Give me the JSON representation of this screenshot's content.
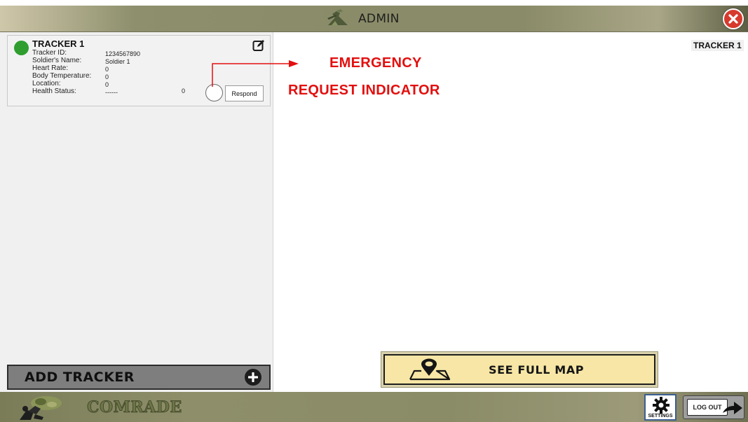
{
  "header": {
    "title": "ADMIN",
    "close_icon": "close-icon",
    "header_icon": "soldier-salute-icon"
  },
  "tracker_card": {
    "title": "TRACKER 1",
    "status_color": "#2f9e2f",
    "fields": [
      {
        "label": "Tracker ID:",
        "value": "1234567890"
      },
      {
        "label": "Soldier's Name:",
        "value": "Soldier 1"
      },
      {
        "label": "Heart Rate:",
        "value": "0"
      },
      {
        "label": "Body Temperature:",
        "value": "0"
      },
      {
        "label": "Location:",
        "value": "0"
      },
      {
        "label": "Health Status:",
        "value": "------"
      }
    ],
    "location_secondary": "0",
    "respond_label": "Respond"
  },
  "add_tracker": {
    "label": "ADD TRACKER"
  },
  "right_panel": {
    "tracker_tag": "TRACKER 1",
    "annotation_line1": "EMERGENCY",
    "annotation_line2": "REQUEST INDICATOR",
    "annotation_color": "#e30f0f",
    "map_button_label": "SEE FULL MAP"
  },
  "footer": {
    "brand": "COMRADE",
    "settings_label": "SETTINGS",
    "logout_label": "LOG OUT"
  }
}
